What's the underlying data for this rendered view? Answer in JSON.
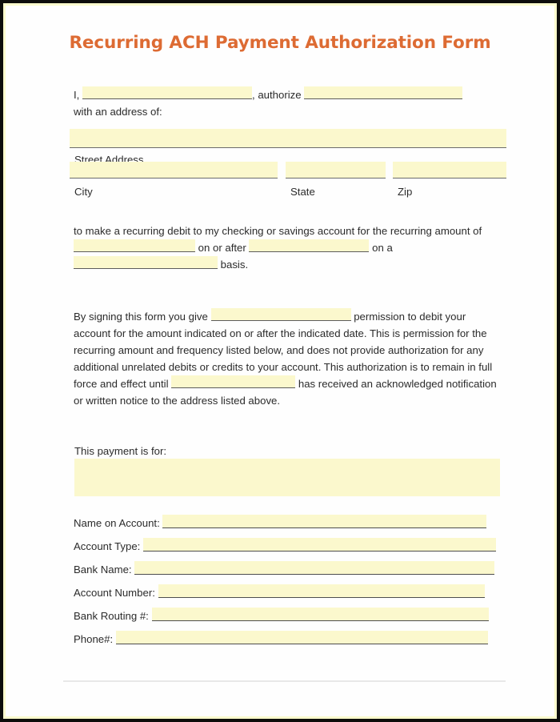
{
  "document": {
    "title": "Recurring ACH Payment Authorization Form",
    "title_color": "#dd6b33",
    "highlight_color": "#fbf8cd",
    "intro": {
      "prefix": "I,",
      "middle": ", authorize",
      "address_intro": "with an address of:"
    },
    "address": {
      "street_label": "Street Address",
      "city_label": "City",
      "state_label": "State",
      "zip_label": "Zip"
    },
    "recurring_paragraph": {
      "line1": "to make a recurring debit to my checking or savings account for the recurring",
      "line2_prefix": "amount of",
      "line2_middle": "on or after",
      "line2_suffix": "on a",
      "line3_suffix": "basis."
    },
    "signing_paragraph": {
      "part1": "By signing this form you give",
      "part2": "permission to debit your account for the amount indicated on or after the indicated date.  This is permission for the recurring amount and frequency listed below, and does not provide authorization for any additional unrelated debits or credits to your account.  This authorization is to remain in full force and effect until",
      "part3": "has received an acknowledged notification or written notice to the address listed above."
    },
    "payment_for": {
      "label": "This payment is for:",
      "value": ""
    },
    "details": [
      {
        "label": "Name on Account:",
        "value": ""
      },
      {
        "label": "Account Type:",
        "value": ""
      },
      {
        "label": "Bank Name:",
        "value": ""
      },
      {
        "label": "Account Number:",
        "value": ""
      },
      {
        "label": "Bank Routing #:",
        "value": ""
      },
      {
        "label": "Phone#:",
        "value": ""
      }
    ]
  }
}
